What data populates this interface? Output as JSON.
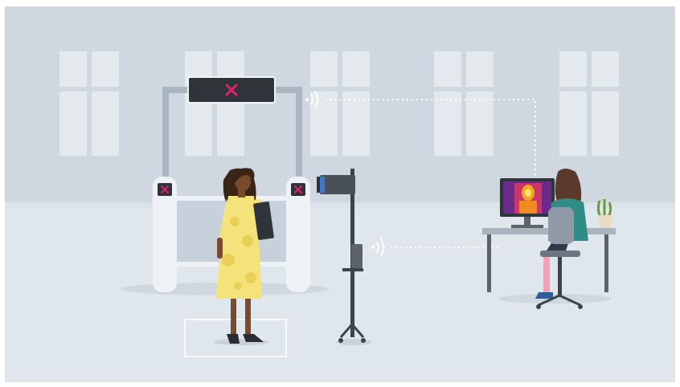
{
  "scene": {
    "colors": {
      "wall": "#cfd8e0",
      "floor": "#dfe6ec",
      "window": "#e4e9ee",
      "gate": "#eef2f5",
      "gate_frame": "#aab6c2",
      "display": "#2f343b",
      "alert": "#e0226e",
      "signal_line": "#ffffff",
      "dress": "#f4e27a",
      "skin": "#7a4a2e",
      "hair": "#3a2416",
      "shirt": "#2f8c86",
      "chair": "#8f9aa6",
      "desk": "#a9b3bd",
      "plant": "#6a9a3c",
      "pot": "#e9dcc7"
    },
    "icons": [
      "barrier-alert-icon",
      "wireless-signal-icon",
      "thermal-camera-icon",
      "thermal-image-icon",
      "plant-icon"
    ]
  }
}
